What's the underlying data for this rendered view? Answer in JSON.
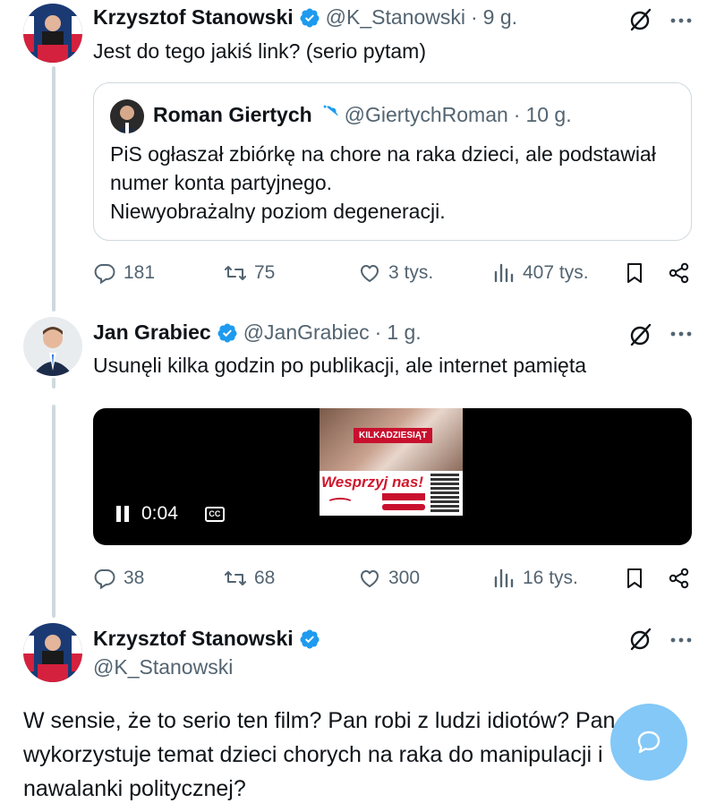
{
  "tweet1": {
    "name": "Krzysztof Stanowski",
    "handle": "@K_Stanowski",
    "separator": "·",
    "time": "9 g.",
    "text": "Jest do tego jakiś link? (serio pytam)",
    "quote": {
      "name": "Roman Giertych",
      "handle": "@GiertychRoman",
      "separator": "·",
      "time": "10 g.",
      "lines": [
        "PiS ogłaszał zbiórkę na chore na raka dzieci, ale podstawiał",
        "numer konta partyjnego.",
        "Niewyobrażalny poziom degeneracji."
      ]
    },
    "actions": {
      "replies": "181",
      "reposts": "75",
      "likes": "3 tys.",
      "views": "407 tys."
    }
  },
  "tweet2": {
    "name": "Jan Grabiec",
    "handle": "@JanGrabiec",
    "separator": "·",
    "time": "1 g.",
    "text": "Usunęli kilka godzin po publikacji, ale internet pamięta",
    "video": {
      "time": "0:04",
      "cc_label": "CC",
      "frame_banner": "KILKADZIESIĄT",
      "frame_title": "Wesprzyj nas!"
    },
    "actions": {
      "replies": "38",
      "reposts": "68",
      "likes": "300",
      "views": "16 tys."
    }
  },
  "tweet3": {
    "name": "Krzysztof Stanowski",
    "handle": "@K_Stanowski",
    "lines": [
      "W sensie, że to serio ten film? Pan robi z ludzi idiotów? Pan",
      "wykorzystuje temat dzieci chorych na raka do manipulacji i",
      "nawalanki politycznej?"
    ]
  },
  "colors": {
    "accent": "#1d9bf0",
    "text": "#0f1419",
    "muted": "#536471",
    "border": "#cfd9de"
  }
}
